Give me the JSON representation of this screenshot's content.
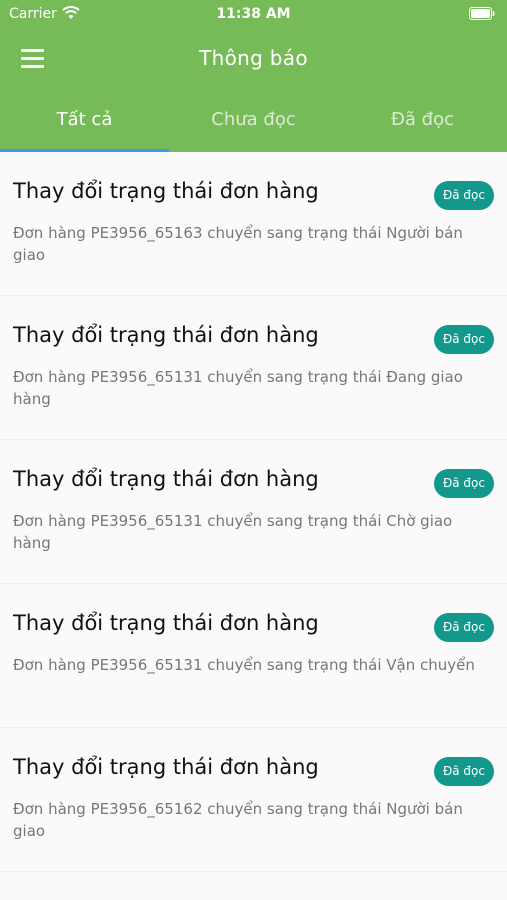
{
  "status_bar": {
    "carrier": "Carrier",
    "time": "11:38 AM"
  },
  "header": {
    "title": "Thông báo"
  },
  "tabs": [
    {
      "label": "Tất cả",
      "active": true
    },
    {
      "label": "Chưa đọc",
      "active": false
    },
    {
      "label": "Đã đọc",
      "active": false
    }
  ],
  "notifications": [
    {
      "title": "Thay đổi trạng thái đơn hàng",
      "description": "Đơn hàng PE3956_65163 chuyển sang trạng thái Người bán giao",
      "badge": "Đã đọc"
    },
    {
      "title": "Thay đổi trạng thái đơn hàng",
      "description": "Đơn hàng PE3956_65131 chuyển sang trạng thái Đang giao hàng",
      "badge": "Đã đọc"
    },
    {
      "title": "Thay đổi trạng thái đơn hàng",
      "description": "Đơn hàng PE3956_65131 chuyển sang trạng thái Chờ giao hàng",
      "badge": "Đã đọc"
    },
    {
      "title": "Thay đổi trạng thái đơn hàng",
      "description": "Đơn hàng PE3956_65131 chuyển sang trạng thái Vận chuyển",
      "badge": "Đã đọc"
    },
    {
      "title": "Thay đổi trạng thái đơn hàng",
      "description": "Đơn hàng PE3956_65162 chuyển sang trạng thái Người bán giao",
      "badge": "Đã đọc"
    }
  ],
  "colors": {
    "header": "#77bb59",
    "badge": "#12988c",
    "tab_indicator": "#3d9be9"
  },
  "icons": {
    "menu": "hamburger-menu-icon",
    "wifi": "wifi-icon",
    "battery": "battery-icon"
  }
}
